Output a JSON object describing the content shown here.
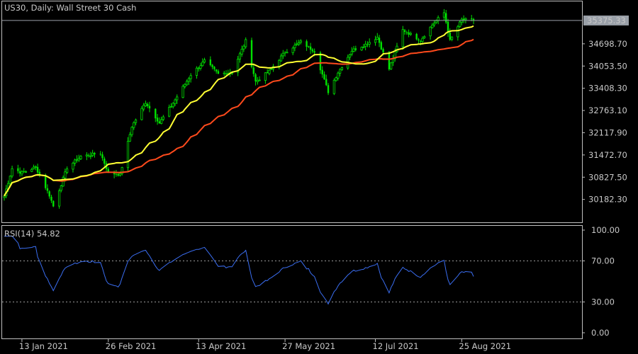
{
  "chart_data": {
    "type": "candlestick",
    "symbol": "US30",
    "timeframe": "Daily",
    "instrument": "Wall Street 30 Cash",
    "title": "US30, Daily:  Wall Street 30 Cash",
    "current_price": "35375.33",
    "price_ticks": [
      "34698.70",
      "34053.50",
      "33408.30",
      "32763.10",
      "32117.90",
      "31472.70",
      "30827.50",
      "30182.30"
    ],
    "price_range": [
      29600,
      35600
    ],
    "date_ticks": [
      "13 Jan 2021",
      "26 Feb 2021",
      "13 Apr 2021",
      "27 May 2021",
      "12 Jul 2021",
      "25 Aug 2021"
    ],
    "close_anchors": [
      [
        "2021-01-04",
        30280
      ],
      [
        "2021-01-08",
        31080
      ],
      [
        "2021-01-13",
        30950
      ],
      [
        "2021-01-20",
        31120
      ],
      [
        "2021-01-27",
        30300
      ],
      [
        "2021-01-29",
        29980
      ],
      [
        "2021-02-05",
        31100
      ],
      [
        "2021-02-12",
        31430
      ],
      [
        "2021-02-22",
        31520
      ],
      [
        "2021-02-26",
        30950
      ],
      [
        "2021-03-04",
        30900
      ],
      [
        "2021-03-10",
        32300
      ],
      [
        "2021-03-17",
        33000
      ],
      [
        "2021-03-24",
        32400
      ],
      [
        "2021-03-31",
        32980
      ],
      [
        "2021-04-09",
        33800
      ],
      [
        "2021-04-16",
        34200
      ],
      [
        "2021-04-23",
        33820
      ],
      [
        "2021-04-30",
        33880
      ],
      [
        "2021-05-07",
        34780
      ],
      [
        "2021-05-12",
        33600
      ],
      [
        "2021-05-19",
        33900
      ],
      [
        "2021-05-27",
        34460
      ],
      [
        "2021-06-04",
        34750
      ],
      [
        "2021-06-11",
        34480
      ],
      [
        "2021-06-18",
        33300
      ],
      [
        "2021-06-23",
        33870
      ],
      [
        "2021-06-30",
        34500
      ],
      [
        "2021-07-07",
        34680
      ],
      [
        "2021-07-13",
        34890
      ],
      [
        "2021-07-19",
        33960
      ],
      [
        "2021-07-26",
        35100
      ],
      [
        "2021-08-04",
        34800
      ],
      [
        "2021-08-10",
        35250
      ],
      [
        "2021-08-16",
        35600
      ],
      [
        "2021-08-19",
        34780
      ],
      [
        "2021-08-25",
        35400
      ],
      [
        "2021-08-31",
        35375
      ]
    ],
    "ma_fast": {
      "color": "#ffff33",
      "period": 20
    },
    "ma_slow": {
      "color": "#ff4a1c",
      "period": 50
    },
    "candle_color": "#00e000",
    "rsi": {
      "label": "RSI(14) 54.82",
      "period": 14,
      "value": 54.82,
      "levels": [
        70,
        30
      ],
      "ticks": [
        "100.00",
        "70.00",
        "30.00",
        "0.00"
      ],
      "color": "#3a6df0"
    },
    "grid": false,
    "legend": "none"
  }
}
